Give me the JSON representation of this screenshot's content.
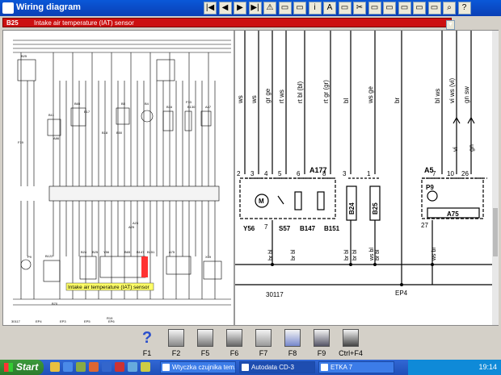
{
  "window": {
    "title": "Wiring diagram"
  },
  "toolbar": {
    "buttons": [
      {
        "name": "first-page-button",
        "glyph": "|◀"
      },
      {
        "name": "prev-page-button",
        "glyph": "◀"
      },
      {
        "name": "next-page-button",
        "glyph": "▶"
      },
      {
        "name": "last-page-button",
        "glyph": "▶|"
      },
      {
        "name": "warning-button",
        "glyph": "⚠"
      },
      {
        "name": "folder-button",
        "glyph": "▭"
      },
      {
        "name": "folder2-button",
        "glyph": "▭"
      },
      {
        "name": "index-button",
        "glyph": "i"
      },
      {
        "name": "text-button",
        "glyph": "A"
      },
      {
        "name": "book-button",
        "glyph": "▭"
      },
      {
        "name": "scissors-button",
        "glyph": "✂"
      },
      {
        "name": "open-button",
        "glyph": "▭"
      },
      {
        "name": "save-button",
        "glyph": "▭"
      },
      {
        "name": "doc-button",
        "glyph": "▭"
      },
      {
        "name": "doc2-button",
        "glyph": "▭"
      },
      {
        "name": "doc3-button",
        "glyph": "▭"
      },
      {
        "name": "search-button",
        "glyph": "⌕"
      },
      {
        "name": "help-button",
        "glyph": "?"
      }
    ]
  },
  "selector": {
    "code": "B25",
    "label": "Intake air temperature (IAT) sensor",
    "exit": "◂▯"
  },
  "mini_diagram": {
    "highlight_label": "Intake air temperature (IAT) sensor",
    "labels": [
      "B25",
      "F19",
      "A86",
      "B5",
      "A23",
      "F33",
      "B65",
      "B4",
      "B16",
      "B130",
      "A47",
      "B11",
      "B17",
      "B18",
      "B50",
      "B65",
      "B147",
      "B151",
      "Y56",
      "A75",
      "A25",
      "B122",
      "B24",
      "B25",
      "B70",
      "P9",
      "X69",
      "R19",
      "30117",
      "EP4",
      "EP3",
      "EP5",
      "EP6"
    ]
  },
  "main_diagram": {
    "top_wires": [
      "ws",
      "ws",
      "gr ge",
      "rt ws",
      "rt bl (bl)",
      "rt gr (gr)",
      "bl",
      "ws ge",
      "br",
      "bl ws",
      "vi ws (vi)",
      "gn sw"
    ],
    "pins_left": [
      "2",
      "3",
      "4",
      "5",
      "6",
      "8"
    ],
    "pins_mid": [
      "3",
      "1"
    ],
    "pins_right": [
      "7",
      "10",
      "26"
    ],
    "components": {
      "a177": "A177",
      "a5": "A5",
      "p9": "P9",
      "a75": "A75",
      "y56": "Y56",
      "s57": "S57",
      "b147": "B147",
      "b151": "B151",
      "b24": "B24",
      "b25": "B25",
      "m": "M"
    },
    "lower_wires": [
      "br bl",
      "br bl",
      "br bl",
      "br bl",
      "ws bl",
      "br bl",
      "ws br"
    ],
    "mid_pin": "7",
    "a5_pin": "27",
    "right_vi": "vi",
    "right_gn": "gn",
    "ground_30117": "30117",
    "ground_ep4": "EP4"
  },
  "function_keys": [
    {
      "key": "F1",
      "icon": "help-icon",
      "glyph": "?"
    },
    {
      "key": "F2",
      "icon": "printer-icon",
      "glyph": ""
    },
    {
      "key": "F5",
      "icon": "print-preview-icon",
      "glyph": ""
    },
    {
      "key": "F6",
      "icon": "save-disk-icon",
      "glyph": ""
    },
    {
      "key": "F7",
      "icon": "wrench-icon",
      "glyph": ""
    },
    {
      "key": "F8",
      "icon": "zoom-icon",
      "glyph": ""
    },
    {
      "key": "F9",
      "icon": "measure-icon",
      "glyph": ""
    },
    {
      "key": "Ctrl+F4",
      "icon": "calculator-icon",
      "glyph": ""
    }
  ],
  "taskbar": {
    "start": "Start",
    "tasks": [
      "Wtyczka czujnika tem...",
      "Autodata CD-3",
      "ETKA 7"
    ],
    "clock": "19:14"
  },
  "colors": {
    "accent_red": "#cc1010",
    "title_blue": "#0a4fc8",
    "taskbar_blue": "#2a5fd0",
    "start_green": "#3c9a3c"
  }
}
